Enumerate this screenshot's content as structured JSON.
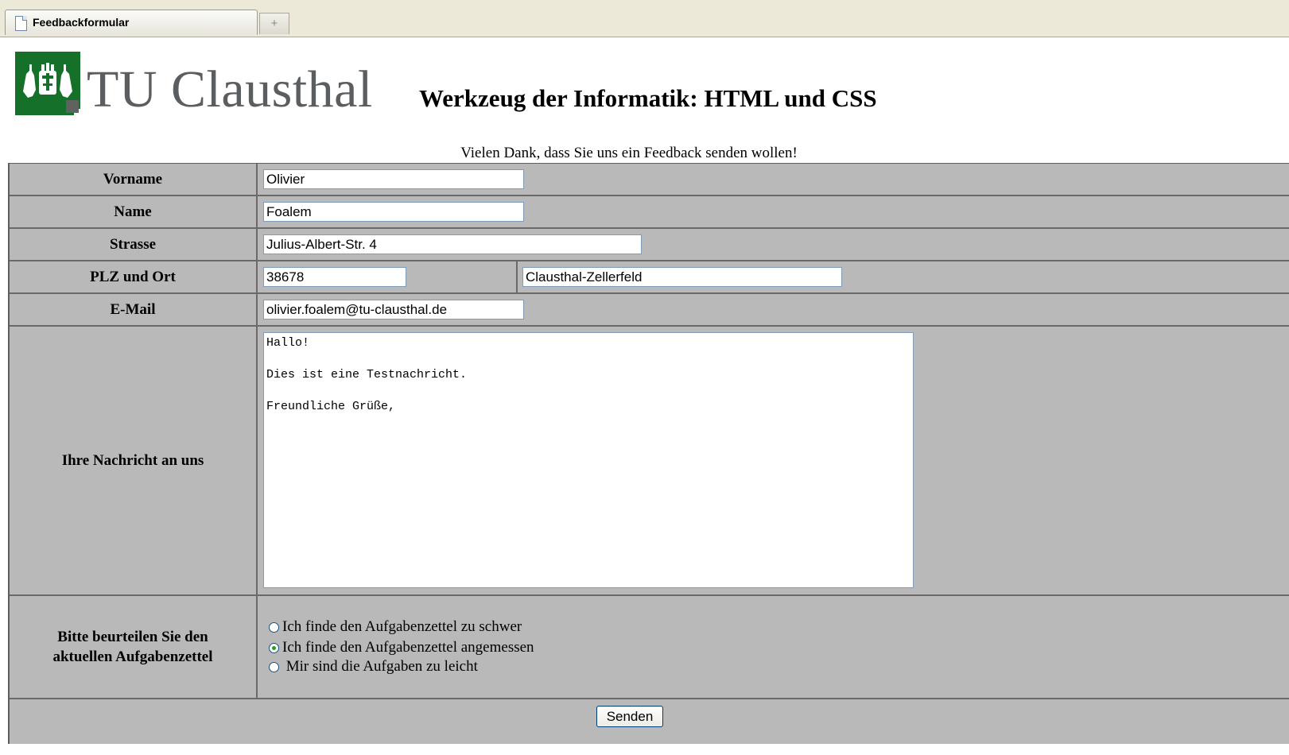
{
  "browser": {
    "tab_title": "Feedbackformular",
    "new_tab_glyph": "+"
  },
  "header": {
    "logo_text": "TU Clausthal",
    "logo_color": "#157029",
    "page_heading": "Werkzeug der Informatik: HTML und CSS",
    "intro": "Vielen Dank, dass Sie uns ein Feedback senden wollen!"
  },
  "form": {
    "vorname": {
      "label": "Vorname",
      "value": "Olivier"
    },
    "name": {
      "label": "Name",
      "value": "Foalem"
    },
    "strasse": {
      "label": "Strasse",
      "value": "Julius-Albert-Str. 4"
    },
    "plz_ort": {
      "label": "PLZ und Ort",
      "plz": "38678",
      "ort": "Clausthal-Zellerfeld"
    },
    "email": {
      "label": "E-Mail",
      "value": "olivier.foalem@tu-clausthal.de"
    },
    "nachricht": {
      "label": "Ihre Nachricht an uns",
      "value": "Hallo!\n\nDies ist eine Testnachricht.\n\nFreundliche Grüße,"
    },
    "bewertung": {
      "label": "Bitte beurteilen Sie den aktuellen Aufgabenzettel",
      "options": [
        {
          "label": "Ich finde den Aufgabenzettel zu schwer",
          "checked": false
        },
        {
          "label": "Ich finde den Aufgabenzettel angemessen",
          "checked": true
        },
        {
          "label": " Mir sind die Aufgaben zu leicht",
          "checked": false
        }
      ]
    },
    "submit_label": "Senden"
  },
  "colors": {
    "form_background": "#b9b9b9",
    "border": "#5e5e5e"
  }
}
